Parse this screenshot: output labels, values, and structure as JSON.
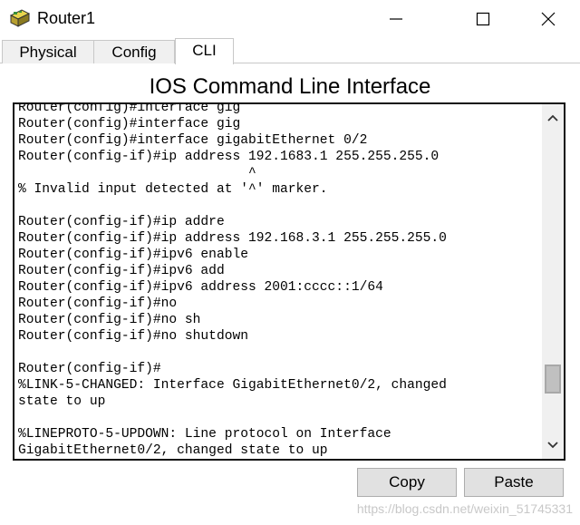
{
  "window": {
    "title": "Router1",
    "icon": "router-icon"
  },
  "tabs": [
    {
      "label": "Physical",
      "selected": false
    },
    {
      "label": "Config",
      "selected": false
    },
    {
      "label": "CLI",
      "selected": true
    }
  ],
  "heading": "IOS Command Line Interface",
  "console": {
    "lines": [
      "Router(config)#interface gig",
      "Router(config)#interface gig",
      "Router(config)#interface gigabitEthernet 0/2",
      "Router(config-if)#ip address 192.1683.1 255.255.255.0",
      "                             ^",
      "% Invalid input detected at '^' marker.",
      "",
      "Router(config-if)#ip addre",
      "Router(config-if)#ip address 192.168.3.1 255.255.255.0",
      "Router(config-if)#ipv6 enable",
      "Router(config-if)#ipv6 add",
      "Router(config-if)#ipv6 address 2001:cccc::1/64",
      "Router(config-if)#no",
      "Router(config-if)#no sh",
      "Router(config-if)#no shutdown",
      "",
      "Router(config-if)#",
      "%LINK-5-CHANGED: Interface GigabitEthernet0/2, changed",
      "state to up",
      "",
      "%LINEPROTO-5-UPDOWN: Line protocol on Interface",
      "GigabitEthernet0/2, changed state to up"
    ]
  },
  "buttons": {
    "copy": "Copy",
    "paste": "Paste"
  },
  "watermark": "https://blog.csdn.net/weixin_51745331"
}
